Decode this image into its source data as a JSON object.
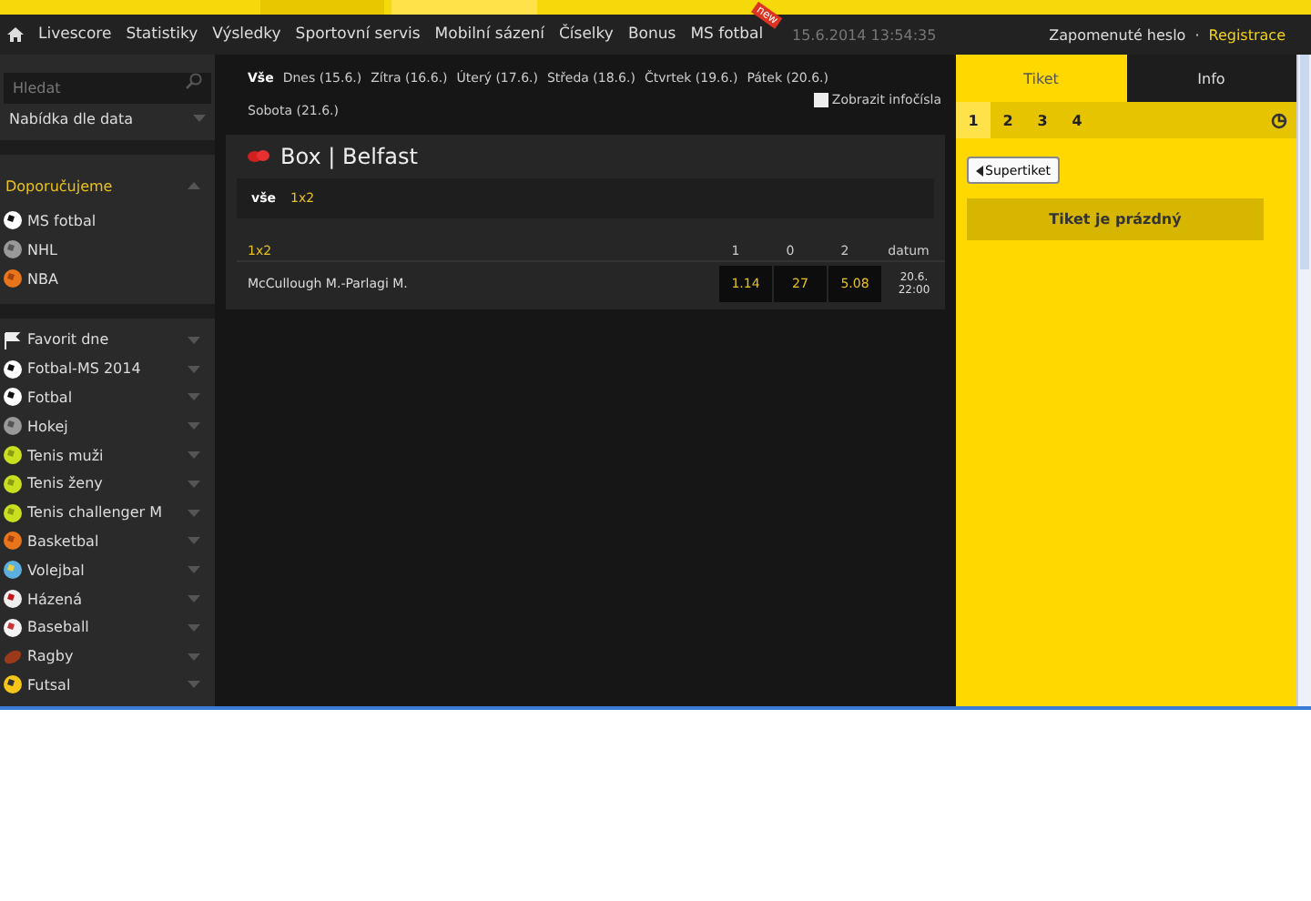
{
  "nav": {
    "items": [
      {
        "label": "Livescore"
      },
      {
        "label": "Statistiky"
      },
      {
        "label": "Výsledky"
      },
      {
        "label": "Sportovní servis"
      },
      {
        "label": "Mobilní sázení"
      },
      {
        "label": "Číselky"
      },
      {
        "label": "Bonus"
      },
      {
        "label": "MS fotbal",
        "badge": "new"
      }
    ],
    "datetime": "15.6.2014 13:54:35"
  },
  "account": {
    "forgot": "Zapomenuté heslo",
    "separator": "·",
    "register": "Registrace"
  },
  "sidebar": {
    "search": {
      "placeholder": "Hledat"
    },
    "offer": "Nabídka dle data",
    "recommended": {
      "title": "Doporučujeme",
      "items": [
        {
          "label": "MS fotbal",
          "kind": "soccer"
        },
        {
          "label": "NHL",
          "kind": "hockey"
        },
        {
          "label": "NBA",
          "kind": "basketball"
        }
      ]
    },
    "sports": [
      {
        "label": "Favorit dne",
        "kind": "flag"
      },
      {
        "label": "Fotbal-MS 2014",
        "kind": "soccer"
      },
      {
        "label": "Fotbal",
        "kind": "soccer"
      },
      {
        "label": "Hokej",
        "kind": "hockey"
      },
      {
        "label": "Tenis muži",
        "kind": "tennis"
      },
      {
        "label": "Tenis ženy",
        "kind": "tennis"
      },
      {
        "label": "Tenis challenger M",
        "kind": "tennis"
      },
      {
        "label": "Basketbal",
        "kind": "basketball"
      },
      {
        "label": "Volejbal",
        "kind": "volleyball"
      },
      {
        "label": "Házená",
        "kind": "handball"
      },
      {
        "label": "Baseball",
        "kind": "baseball"
      },
      {
        "label": "Ragby",
        "kind": "rugby"
      },
      {
        "label": "Futsal",
        "kind": "futsal"
      }
    ]
  },
  "dates": [
    {
      "label": "Vše",
      "selected": true
    },
    {
      "label": "Dnes (15.6.)",
      "selected": false
    },
    {
      "label": "Zítra (16.6.)",
      "selected": false
    },
    {
      "label": "Úterý (17.6.)",
      "selected": false
    },
    {
      "label": "Středa (18.6.)",
      "selected": false
    },
    {
      "label": "Čtvrtek (19.6.)",
      "selected": false
    },
    {
      "label": "Pátek (20.6.)",
      "selected": false
    },
    {
      "label": "Sobota (21.6.)",
      "selected": false
    }
  ],
  "infocisla": {
    "label": "Zobrazit infočísla",
    "checked": false
  },
  "event": {
    "title": "Box | Belfast",
    "filters": [
      {
        "label": "vše",
        "selected": true
      },
      {
        "label": "1x2",
        "selected": false
      }
    ],
    "market": "1x2",
    "columns": [
      "1",
      "0",
      "2",
      "datum"
    ],
    "rows": [
      {
        "match": "McCullough M.-Parlagi M.",
        "odds": [
          "1.14",
          "27",
          "5.08"
        ],
        "date": "20.6.",
        "time": "22:00"
      }
    ]
  },
  "ticket": {
    "tabs": [
      {
        "label": "Tiket",
        "selected": true
      },
      {
        "label": "Info",
        "selected": false
      }
    ],
    "numbers": [
      {
        "label": "1",
        "selected": true
      },
      {
        "label": "2",
        "selected": false
      },
      {
        "label": "3",
        "selected": false
      },
      {
        "label": "4",
        "selected": false
      }
    ],
    "supertiket": "Supertiket",
    "empty": "Tiket je prázdný"
  }
}
